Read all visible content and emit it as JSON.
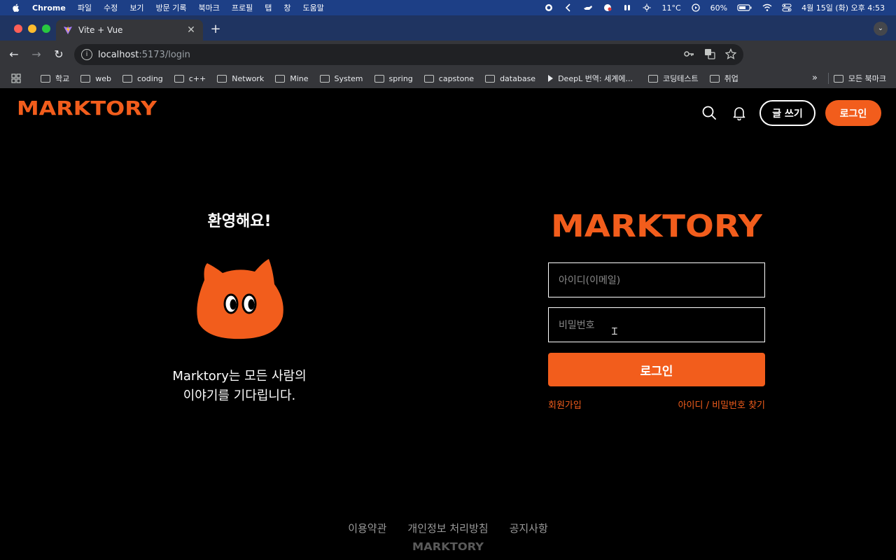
{
  "menubar": {
    "app_name": "Chrome",
    "menus": [
      "파일",
      "수정",
      "보기",
      "방문 기록",
      "북마크",
      "프로필",
      "탭",
      "창",
      "도움말"
    ],
    "temperature": "11°C",
    "battery": "60%",
    "datetime": "4월 15일 (화) 오후 4:53"
  },
  "browser": {
    "tab_title": "Vite + Vue",
    "url_host": "localhost",
    "url_path": ":5173/login",
    "bookmarks": [
      "학교",
      "web",
      "coding",
      "c++",
      "Network",
      "Mine",
      "System",
      "spring",
      "capstone",
      "database",
      "DeepL 번역: 세계에...",
      "코딩테스트",
      "취업"
    ],
    "more_bookmarks": "»",
    "all_bookmarks": "모든 북마크"
  },
  "header": {
    "logo_text": "MARKTORY",
    "write_label": "글 쓰기",
    "login_label": "로그인"
  },
  "welcome": {
    "title": "환영해요!",
    "tagline_line1": "Marktory는 모든 사람의",
    "tagline_line2": "이야기를 기다립니다."
  },
  "login_form": {
    "logo_text": "MARKTORY",
    "email_placeholder": "아이디(이메일)",
    "password_placeholder": "비밀번호",
    "submit_label": "로그인",
    "signup_link": "회원가입",
    "find_link": "아이디 / 비밀번호 찾기"
  },
  "footer": {
    "links": [
      "이용약관",
      "개인정보 처리방침",
      "공지사항"
    ],
    "logo_text": "MARKTORY"
  },
  "colors": {
    "brand_orange": "#f25d1c",
    "background": "#000000"
  }
}
